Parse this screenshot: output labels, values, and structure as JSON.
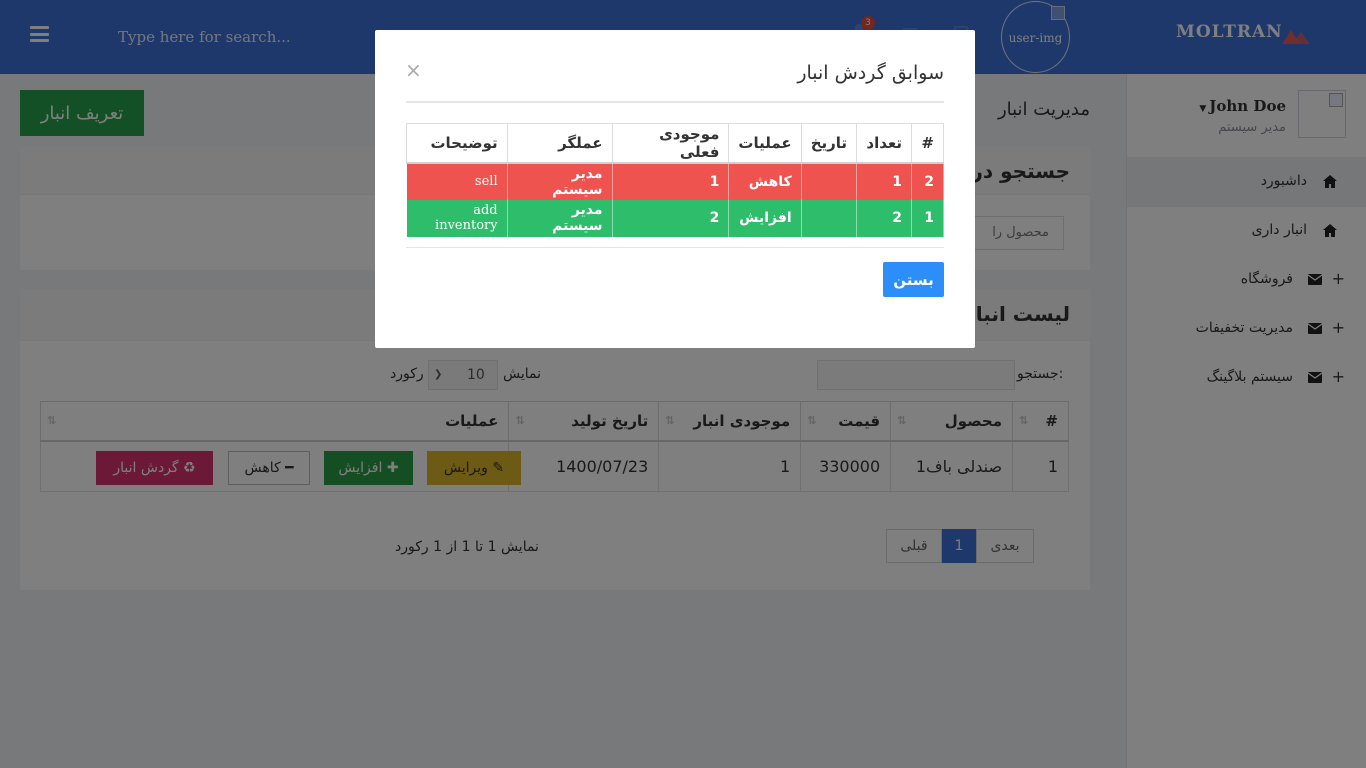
{
  "header": {
    "search_placeholder": "Type here for search...",
    "notification_count": "3",
    "user_img_alt": "user-img",
    "brand": "MOLTRAN"
  },
  "sidebar": {
    "user_name": "John Doe",
    "user_role": "مدیر سیستم",
    "items": [
      {
        "label": "داشبورد",
        "icon": "home-icon",
        "has_plus": false,
        "active": true
      },
      {
        "label": "انبار داری",
        "icon": "home-icon",
        "has_plus": false,
        "active": false
      },
      {
        "label": "فروشگاه",
        "icon": "envelope-icon",
        "has_plus": true,
        "active": false
      },
      {
        "label": "مدیریت تخفیفات",
        "icon": "envelope-icon",
        "has_plus": true,
        "active": false
      },
      {
        "label": "سیستم بلاگینگ",
        "icon": "envelope-icon",
        "has_plus": true,
        "active": false
      }
    ]
  },
  "main": {
    "add_button": "تعریف انبار",
    "page_title": "مدیریت انبار",
    "search_panel": {
      "title": "جستجو در",
      "product_input": "محصول را"
    },
    "list_panel": {
      "title": "لیست انبار",
      "search_label": "جستجو:",
      "show_label": "نمایش",
      "page_size": "10",
      "records_label": "رکورد",
      "columns": [
        "#",
        "محصول",
        "قیمت",
        "موجودی انبار",
        "تاریخ تولید",
        "عملیات"
      ],
      "rows": [
        {
          "num": "1",
          "product": "صندلی باف1",
          "price": "330000",
          "stock": "1",
          "date": "1400/07/23"
        }
      ],
      "buttons": {
        "edit": "ویرایش",
        "increase": "افزایش",
        "decrease": "کاهش",
        "history": "گردش انبار"
      },
      "pager": {
        "next": "بعدی",
        "current": "1",
        "prev": "قبلی"
      },
      "info": "نمایش 1 تا 1 از 1 رکورد"
    }
  },
  "modal": {
    "title": "سوابق گردش انبار",
    "close_symbol": "×",
    "columns": [
      "#",
      "تعداد",
      "تاریخ",
      "عملیات",
      "موجودی فعلی",
      "عملگر",
      "توضیحات"
    ],
    "rows": [
      {
        "num": "2",
        "count": "1",
        "date": "",
        "operation": "کاهش",
        "current_stock": "1",
        "operator": "مدیر سیستم",
        "desc": "sell",
        "status_color": "#ef5350"
      },
      {
        "num": "1",
        "count": "2",
        "date": "",
        "operation": "افزایش",
        "current_stock": "2",
        "operator": "مدیر سیستم",
        "desc": "add inventory",
        "status_color": "#2ebd6a"
      }
    ],
    "close_button": "بستن"
  },
  "colors": {
    "header": "#3d71d8",
    "add_button": "#28a14a",
    "edit_button": "#d9b52b",
    "increase_button": "#2a9c46",
    "history_button": "#d6336c",
    "modal_button": "#2c8ef8"
  }
}
